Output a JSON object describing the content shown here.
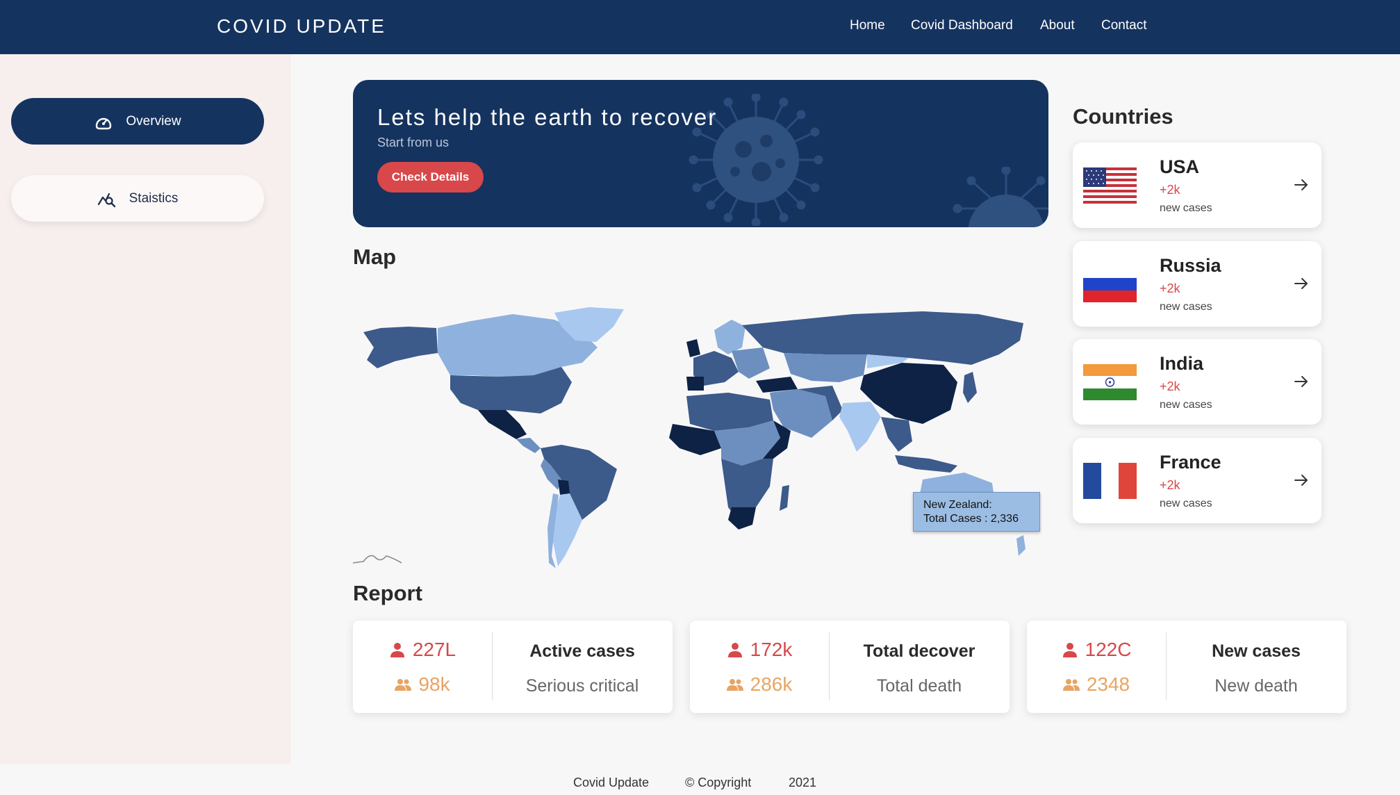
{
  "header": {
    "brand": "COVID UPDATE",
    "nav": [
      "Home",
      "Covid Dashboard",
      "About",
      "Contact"
    ]
  },
  "sidebar": {
    "items": [
      {
        "label": "Overview",
        "icon": "speedometer-icon",
        "active": true
      },
      {
        "label": "Staistics",
        "icon": "chart-search-icon",
        "active": false
      }
    ]
  },
  "banner": {
    "title": "Lets help the earth to recover",
    "subtitle": "Start from us",
    "button": "Check Details"
  },
  "map": {
    "title": "Map",
    "tooltip_line1": "New Zealand:",
    "tooltip_line2": "Total Cases : 2,336"
  },
  "countries": {
    "title": "Countries",
    "items": [
      {
        "name": "USA",
        "delta": "+2k",
        "note": "new cases",
        "flag": "usa-flag"
      },
      {
        "name": "Russia",
        "delta": "+2k",
        "note": "new cases",
        "flag": "russia-flag"
      },
      {
        "name": "India",
        "delta": "+2k",
        "note": "new cases",
        "flag": "india-flag"
      },
      {
        "name": "France",
        "delta": "+2k",
        "note": "new cases",
        "flag": "france-flag"
      }
    ]
  },
  "report": {
    "title": "Report",
    "cards": [
      {
        "value1": "227L",
        "value2": "98k",
        "label1": "Active cases",
        "label2": "Serious critical"
      },
      {
        "value1": "172k",
        "value2": "286k",
        "label1": "Total decover",
        "label2": "Total death"
      },
      {
        "value1": "122C",
        "value2": "2348",
        "label1": "New cases",
        "label2": "New death"
      }
    ]
  },
  "footer": {
    "name": "Covid Update",
    "copyright": "© Copyright",
    "year": "2021"
  },
  "colors": {
    "navy": "#15335f",
    "accent_red": "#d8474a",
    "accent_orange": "#e8a463"
  }
}
